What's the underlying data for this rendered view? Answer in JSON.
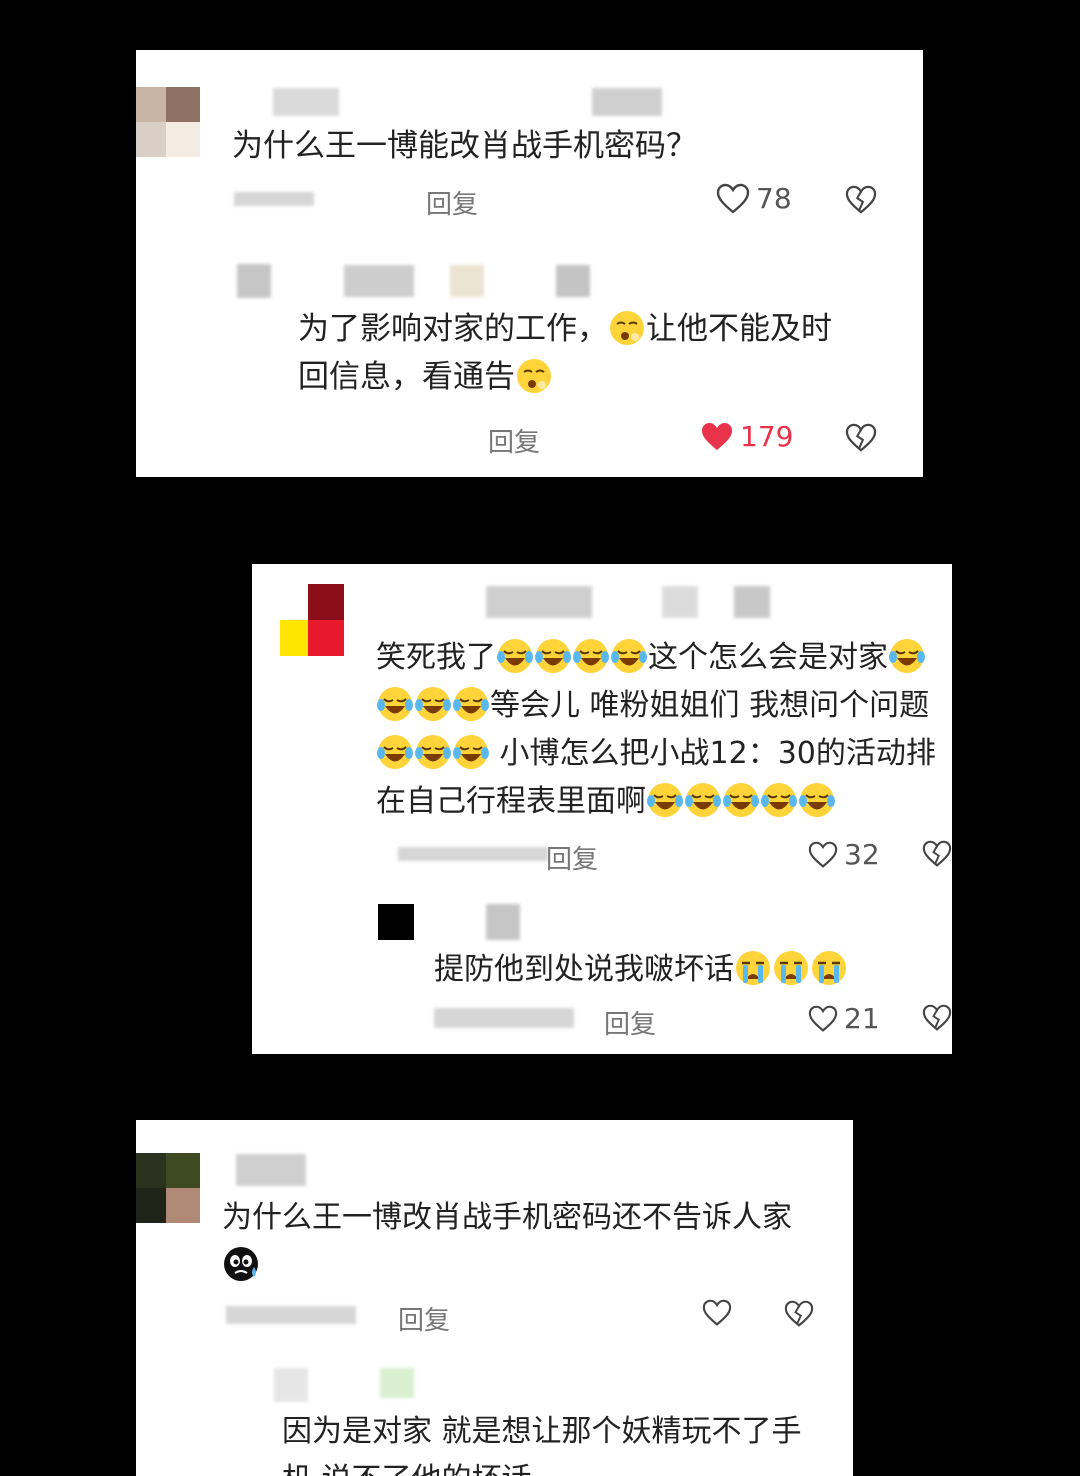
{
  "reply_label": "回复",
  "colors": {
    "like_active": "#e8334a",
    "text": "#222222",
    "muted": "#777777"
  },
  "card1": {
    "comment": {
      "text": "为什么王一博能改肖战手机密码？",
      "likes": "78"
    },
    "reply": {
      "text_a": "为了影响对家的工作，",
      "text_b": "让他不能及时",
      "text_c": "回信息，看通告",
      "likes": "179",
      "emoji": "yawning-emoji"
    }
  },
  "card2": {
    "comment": {
      "line1": "笑死我了",
      "line1b": "这个怎么会是对家",
      "line2": "等会儿 唯粉姐姐们 我想问个问题",
      "line3": " 小博怎么把小战12：30的活动排",
      "line4": "在自己行程表里面啊",
      "likes": "32",
      "emoji": "laugh-cry-emoji"
    },
    "reply": {
      "text": "提防他到处说我啵坏话",
      "likes": "21",
      "emoji": "crying-emoji"
    }
  },
  "card3": {
    "comment": {
      "text": "为什么王一博改肖战手机密码还不告诉人家",
      "emoji": "black-sweat-emoji"
    },
    "reply": {
      "line1": "因为是对家 就是想让那个妖精玩不了手",
      "line2": "机 说不了他的坏话"
    }
  }
}
